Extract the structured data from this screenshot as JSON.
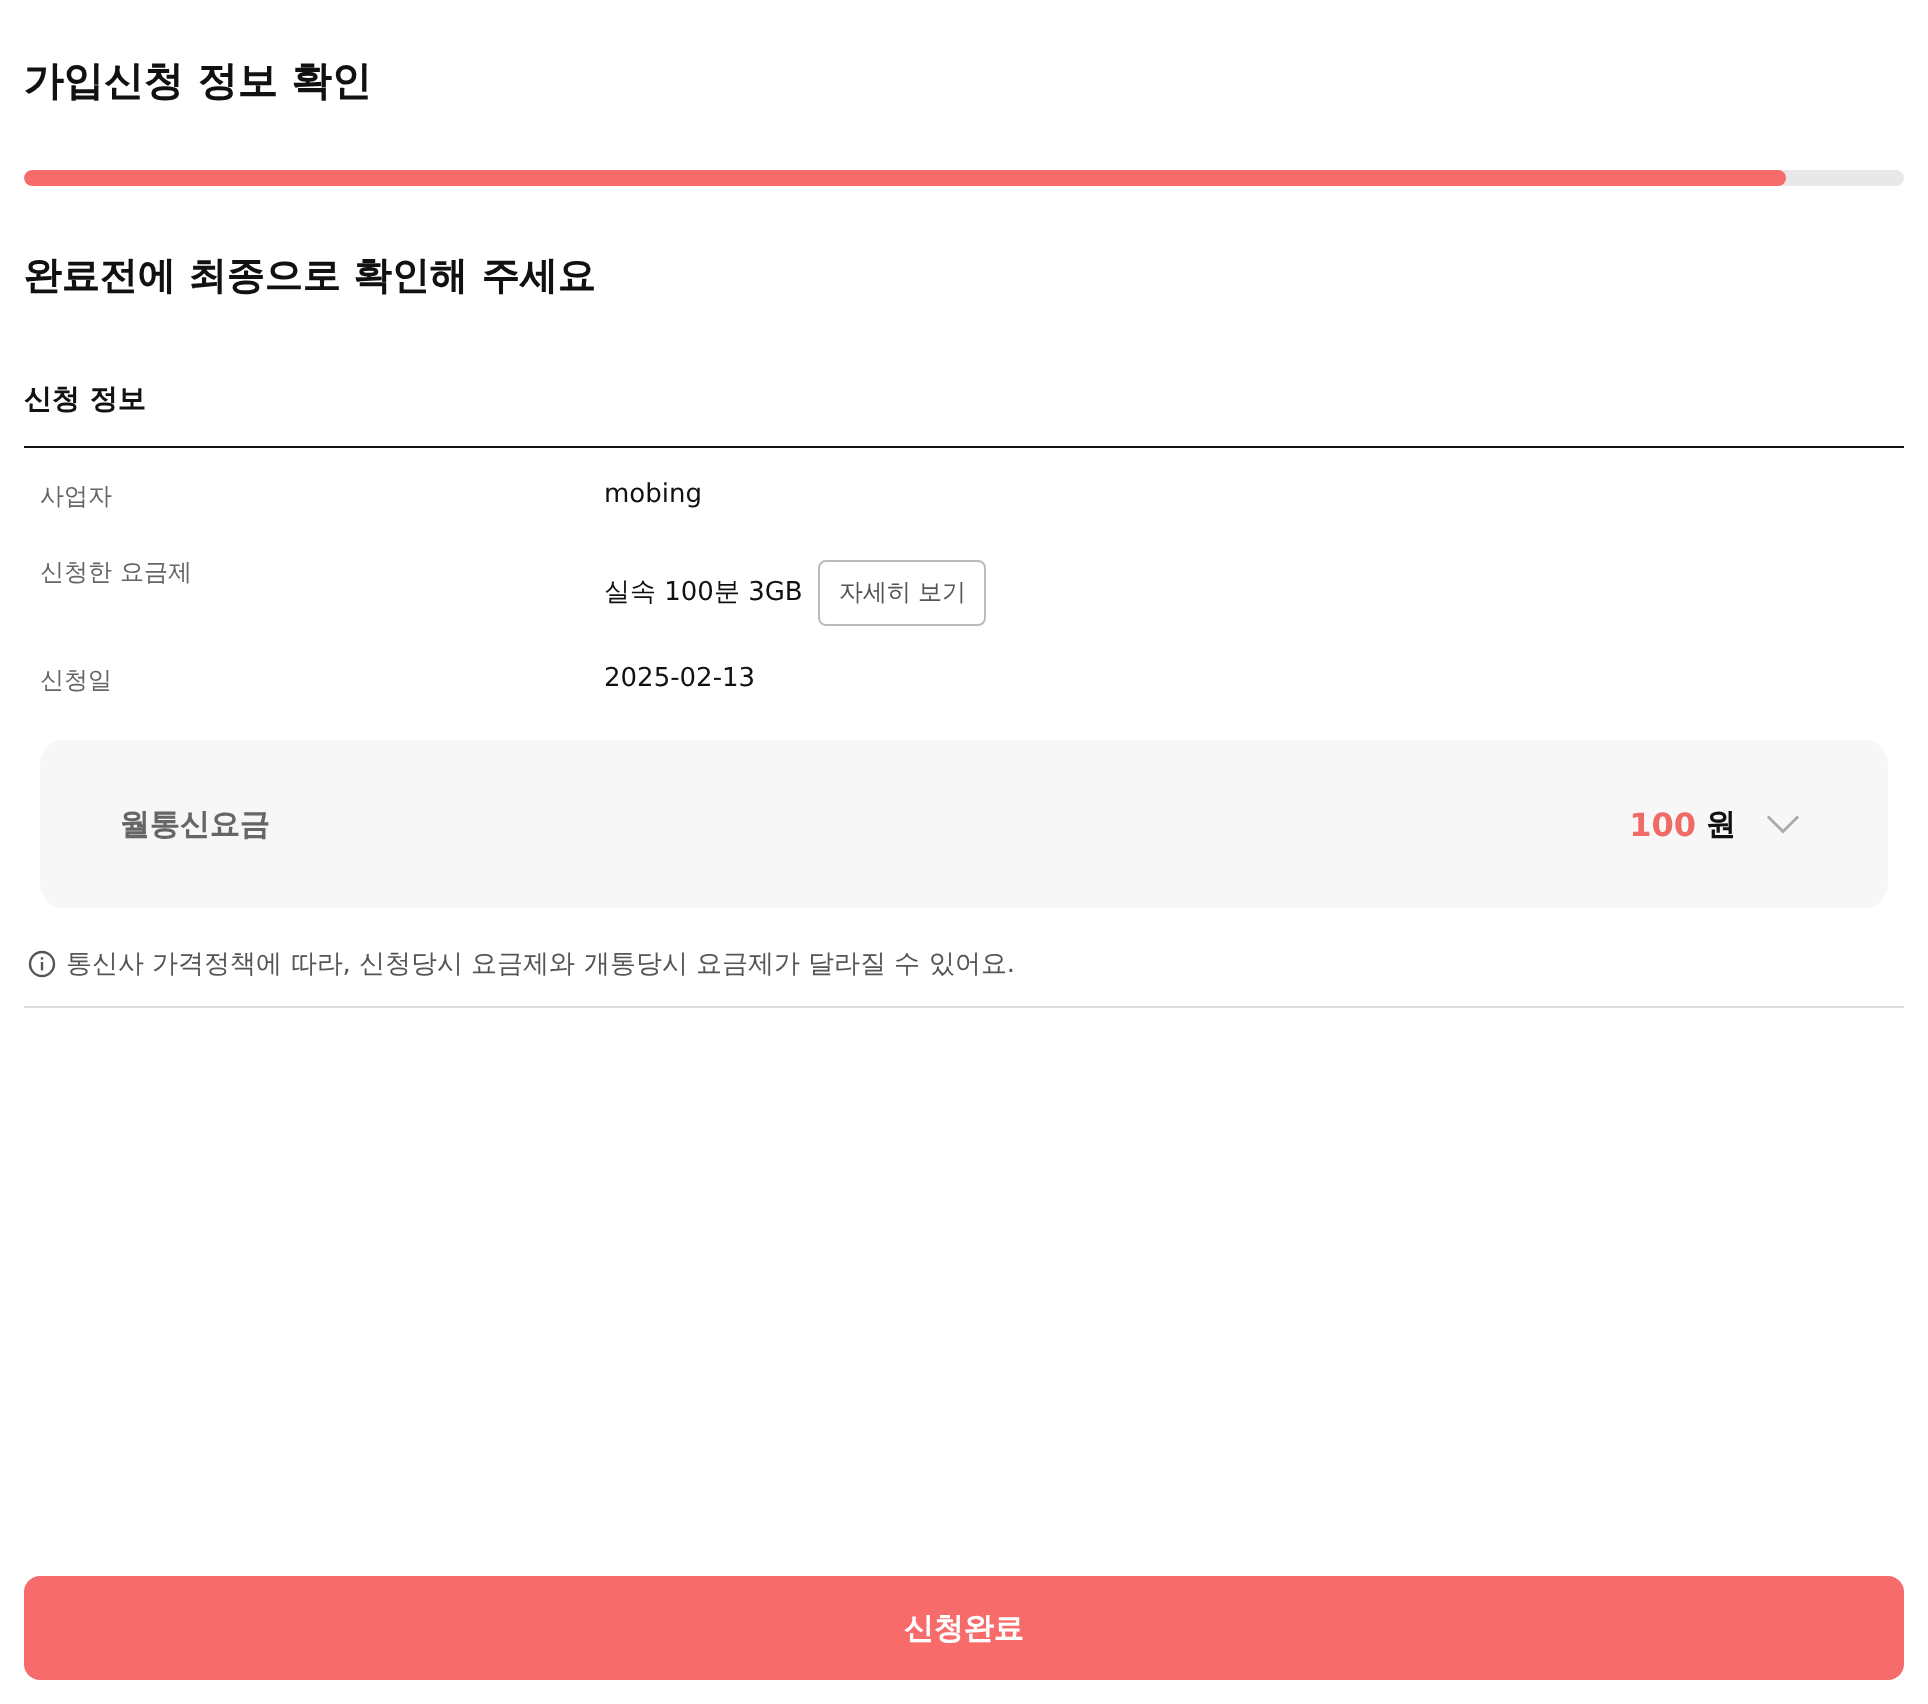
{
  "title": "가입신청 정보 확인",
  "progress": {
    "level": 0.937
  },
  "subtitle": "완료전에 최종으로 확인해 주세요",
  "section": {
    "title": "신청 정보",
    "rows": [
      {
        "label": "사업자",
        "value": "mobing"
      },
      {
        "label": "신청한 요금제",
        "value": "실속 100분 3GB",
        "button": "자세히 보기"
      },
      {
        "label": "신청일",
        "value": "2025-02-13"
      }
    ]
  },
  "fee": {
    "label": "월통신요금",
    "amount": "100",
    "unit": "원",
    "expanded": false
  },
  "notice": "통신사 가격정책에 따라, 신청당시 요금제와 개통당시 요금제가 달라질 수 있어요.",
  "submit": "신청완료"
}
